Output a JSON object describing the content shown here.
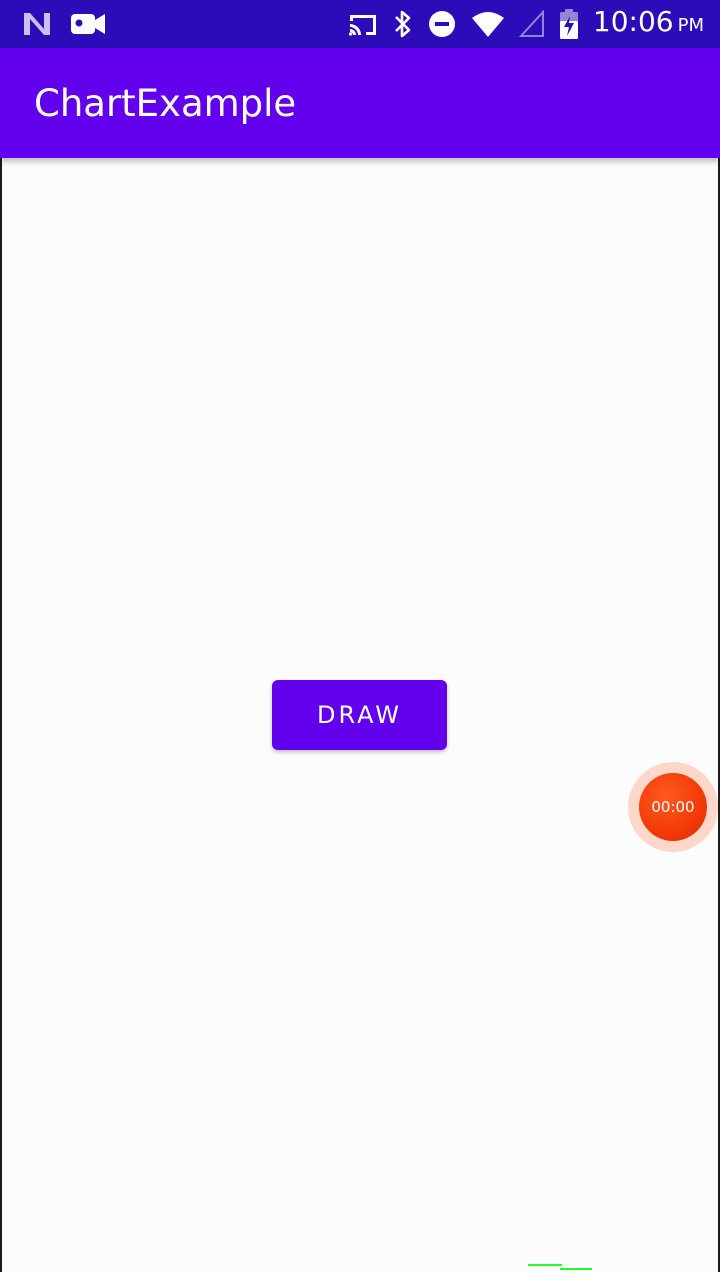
{
  "status_bar": {
    "time": "10:06",
    "ampm": "PM",
    "icons": [
      "n-logo-icon",
      "video-camera-icon",
      "cast-icon",
      "bluetooth-icon",
      "do-not-disturb-icon",
      "wifi-icon",
      "cell-signal-icon",
      "battery-charging-icon"
    ],
    "background_color": "#2d0bb9"
  },
  "app_bar": {
    "title": "ChartExample",
    "background_color": "#6200ee"
  },
  "main": {
    "draw_button_label": "DRAW",
    "button_color": "#6200ee"
  },
  "recorder": {
    "timer": "00:00",
    "color": "#f23a08"
  }
}
